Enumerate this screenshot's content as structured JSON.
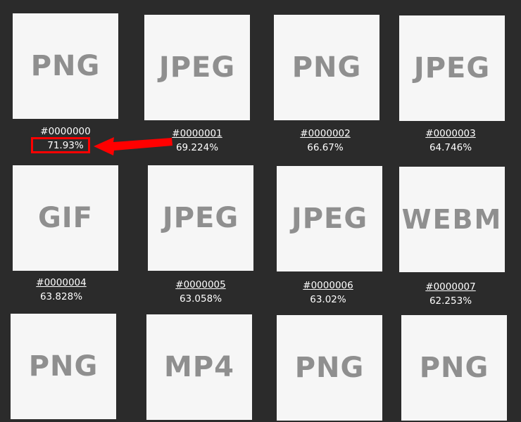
{
  "accent_color": "#ff0000",
  "tiles": [
    {
      "format": "PNG",
      "id": "#0000000",
      "score": "71.93%"
    },
    {
      "format": "JPEG",
      "id": "#0000001",
      "score": "69.224%"
    },
    {
      "format": "PNG",
      "id": "#0000002",
      "score": "66.67%"
    },
    {
      "format": "JPEG",
      "id": "#0000003",
      "score": "64.746%"
    },
    {
      "format": "GIF",
      "id": "#0000004",
      "score": "63.828%"
    },
    {
      "format": "JPEG",
      "id": "#0000005",
      "score": "63.058%"
    },
    {
      "format": "JPEG",
      "id": "#0000006",
      "score": "63.02%"
    },
    {
      "format": "WEBM",
      "id": "#0000007",
      "score": "62.253%"
    },
    {
      "format": "PNG"
    },
    {
      "format": "MP4"
    },
    {
      "format": "PNG"
    },
    {
      "format": "PNG"
    }
  ]
}
